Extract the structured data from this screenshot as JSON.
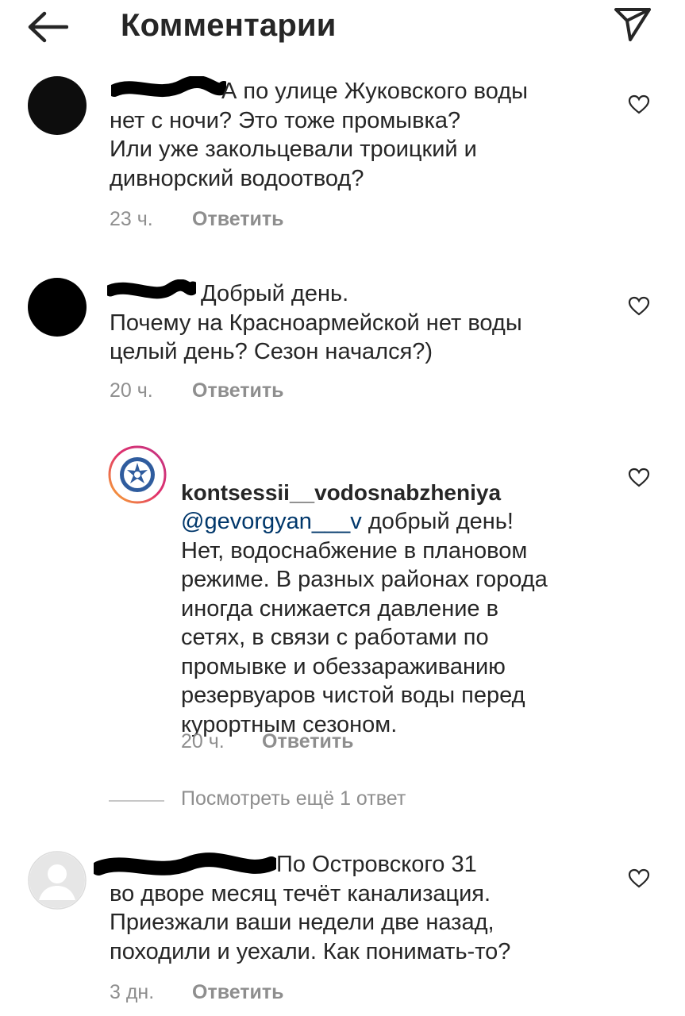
{
  "header": {
    "title": "Комментарии",
    "back_icon": "arrow-left-icon",
    "send_icon": "paper-plane-icon"
  },
  "comments": [
    {
      "text": "А по улице Жуковского воды\nнет с ночи? Это тоже промывка?\nИли уже закольцевали троицкий и\nдивнорский водоотвод?",
      "time": "23 ч.",
      "reply_label": "Ответить"
    },
    {
      "text": "Добрый день.\nПочему на Красноармейской нет воды\nцелый день? Сезон начался?)",
      "time": "20 ч.",
      "reply_label": "Ответить"
    },
    {
      "username": "kontsessii__vodosnabzheniya",
      "mention": "@gevorgyan___v",
      "text": " добрый день!\nНет, водоснабжение в плановом\nрежиме. В разных районах города\nиногда снижается давление в\nсетях, в связи с работами по\nпромывке и обеззараживанию\nрезервуаров чистой воды перед\nкурортным сезоном.",
      "time": "20 ч.",
      "reply_label": "Ответить"
    },
    {
      "text": "По Островского 31\nво дворе месяц течёт канализация.\nПриезжали ваши недели две назад,\nпоходили и уехали. Как понимать-то?",
      "time": "3 дн.",
      "reply_label": "Ответить"
    }
  ],
  "view_more": "Посмотреть ещё 1 ответ",
  "colors": {
    "text": "#262626",
    "secondary": "#8e8e8e",
    "mention": "#00376b",
    "brand_blue": "#2f5c9e"
  }
}
